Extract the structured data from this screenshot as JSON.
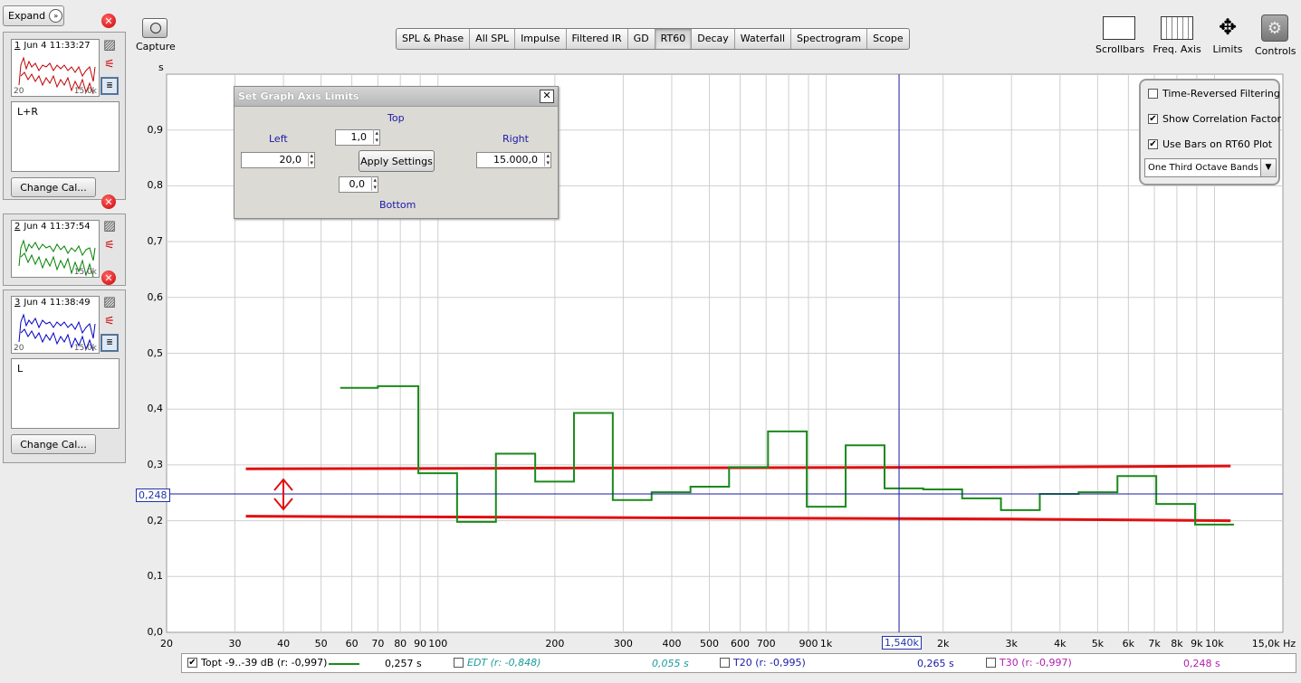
{
  "panel": {
    "expand_label": "Expand",
    "measurements": [
      {
        "index": "1",
        "date": "Jun 4 11:33:27",
        "color": "#c00000",
        "ax_left": "20",
        "ax_right": "15,0k",
        "notes": "L+R",
        "cal_label": "Change Cal..."
      },
      {
        "index": "2",
        "date": "Jun 4 11:37:54",
        "color": "#008000",
        "ax_left": "20",
        "ax_right": "15,0k"
      },
      {
        "index": "3",
        "date": "Jun 4 11:38:49",
        "color": "#0000c0",
        "ax_left": "20",
        "ax_right": "15,0k",
        "notes": "L",
        "cal_label": "Change Cal..."
      }
    ]
  },
  "toolbar": {
    "capture_label": "Capture",
    "tabs": [
      "SPL & Phase",
      "All SPL",
      "Impulse",
      "Filtered IR",
      "GD",
      "RT60",
      "Decay",
      "Waterfall",
      "Spectrogram",
      "Scope"
    ],
    "active_tab": "RT60",
    "tools": {
      "scrollbars": "Scrollbars",
      "freq_axis": "Freq. Axis",
      "limits": "Limits",
      "controls": "Controls"
    }
  },
  "dialog": {
    "title": "Set Graph Axis Limits",
    "top_label": "Top",
    "top_value": "1,0",
    "left_label": "Left",
    "left_value": "20,0",
    "right_label": "Right",
    "right_value": "15.000,0",
    "bottom_label": "Bottom",
    "bottom_value": "0,0",
    "apply_label": "Apply Settings"
  },
  "controls": {
    "options": [
      {
        "label": "Time-Reversed Filtering",
        "checked": false
      },
      {
        "label": "Show Correlation Factor",
        "checked": true
      },
      {
        "label": "Use Bars on RT60 Plot",
        "checked": true
      }
    ],
    "band_select": "One Third Octave Bands"
  },
  "chart_data": {
    "type": "line",
    "title": "",
    "ylabel": "s",
    "xlabel": "Hz",
    "x_scale": "log",
    "xlim": [
      20,
      15000
    ],
    "ylim": [
      0,
      1.0
    ],
    "y_ticks": [
      "0,0",
      "0,1",
      "0,2",
      "0,3",
      "0,4",
      "0,5",
      "0,6",
      "0,7",
      "0,8",
      "0,9"
    ],
    "x_ticks": [
      {
        "v": 20,
        "t": "20"
      },
      {
        "v": 30,
        "t": "30"
      },
      {
        "v": 40,
        "t": "40"
      },
      {
        "v": 50,
        "t": "50"
      },
      {
        "v": 60,
        "t": "60"
      },
      {
        "v": 70,
        "t": "70"
      },
      {
        "v": 80,
        "t": "80"
      },
      {
        "v": 90,
        "t": "90"
      },
      {
        "v": 100,
        "t": "100"
      },
      {
        "v": 200,
        "t": "200"
      },
      {
        "v": 300,
        "t": "300"
      },
      {
        "v": 400,
        "t": "400"
      },
      {
        "v": 500,
        "t": "500"
      },
      {
        "v": 600,
        "t": "600"
      },
      {
        "v": 700,
        "t": "700"
      },
      {
        "v": 900,
        "t": "900"
      },
      {
        "v": 1000,
        "t": "1k"
      },
      {
        "v": 2000,
        "t": "2k"
      },
      {
        "v": 3000,
        "t": "3k"
      },
      {
        "v": 4000,
        "t": "4k"
      },
      {
        "v": 5000,
        "t": "5k"
      },
      {
        "v": 6000,
        "t": "6k"
      },
      {
        "v": 7000,
        "t": "7k"
      },
      {
        "v": 8000,
        "t": "8k"
      },
      {
        "v": 9000,
        "t": "9k"
      },
      {
        "v": 10000,
        "t": "10k"
      },
      {
        "v": 15000,
        "t": "15,0k Hz"
      }
    ],
    "cursor": {
      "x": 1540,
      "y": 0.248,
      "x_label": "1,540k",
      "y_label": "0,248"
    },
    "series": [
      {
        "name": "Topt -9..-39 dB (r: -0,997)",
        "color": "#1a8a1a",
        "steps": [
          [
            56,
            70,
            0.438
          ],
          [
            70,
            89,
            0.441
          ],
          [
            89,
            112,
            0.285
          ],
          [
            112,
            141,
            0.198
          ],
          [
            141,
            178,
            0.32
          ],
          [
            178,
            224,
            0.27
          ],
          [
            224,
            282,
            0.393
          ],
          [
            282,
            355,
            0.237
          ],
          [
            355,
            447,
            0.251
          ],
          [
            447,
            562,
            0.261
          ],
          [
            562,
            708,
            0.296
          ],
          [
            708,
            891,
            0.36
          ],
          [
            891,
            1122,
            0.225
          ],
          [
            1122,
            1413,
            0.335
          ],
          [
            1413,
            1778,
            0.258
          ],
          [
            1778,
            2239,
            0.256
          ],
          [
            2239,
            2818,
            0.24
          ],
          [
            2818,
            3548,
            0.219
          ],
          [
            3548,
            4467,
            0.248
          ],
          [
            4467,
            5623,
            0.251
          ],
          [
            5623,
            7079,
            0.28
          ],
          [
            7079,
            8913,
            0.23
          ],
          [
            8913,
            11220,
            0.193
          ]
        ]
      }
    ],
    "annotations": [
      {
        "type": "line",
        "color": "#e01010",
        "points": [
          [
            32,
            0.293
          ],
          [
            3000,
            0.296
          ],
          [
            11000,
            0.298
          ]
        ]
      },
      {
        "type": "line",
        "color": "#e01010",
        "points": [
          [
            32,
            0.208
          ],
          [
            3000,
            0.203
          ],
          [
            11000,
            0.2
          ]
        ]
      }
    ],
    "legend": [
      {
        "label": "Topt -9..-39 dB (r: -0,997)",
        "checked": true,
        "value": "0,257 s",
        "color": "#1a8a1a"
      },
      {
        "label": "EDT (r: -0,848)",
        "checked": false,
        "value": "0,055 s",
        "color": "#1a9a9a"
      },
      {
        "label": "T20 (r: -0,995)",
        "checked": false,
        "value": "0,265 s",
        "color": "#1a1aa8"
      },
      {
        "label": "T30 (r: -0,997)",
        "checked": false,
        "value": "0,248 s",
        "color": "#b020b0"
      }
    ]
  }
}
